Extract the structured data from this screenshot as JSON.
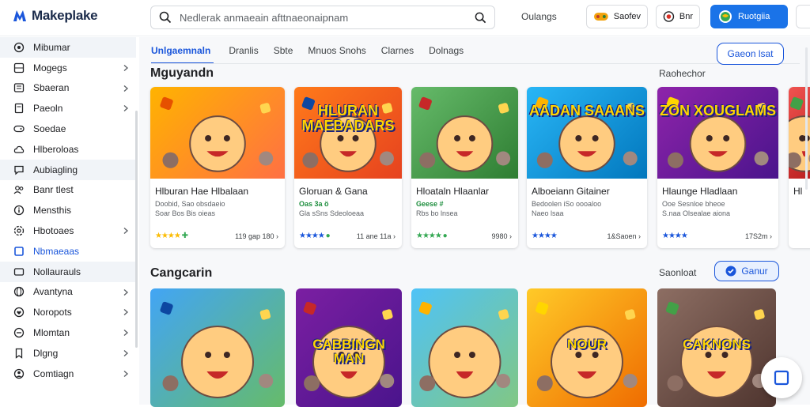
{
  "app": {
    "title": "Makeplake",
    "brand_color": "#1a56db"
  },
  "search": {
    "placeholder": "Nedlerak anmaeain afttnaeonaipnam",
    "icon": "search-icon",
    "action_icon": "search-icon"
  },
  "topbar": {
    "link_label": "Oulangs",
    "btn1_label": "Saofev",
    "btn2_label": "Bnr",
    "btn3_label": "Ruotgiia"
  },
  "sidebar": {
    "items": [
      {
        "label": "Mibumar",
        "icon": "home-icon",
        "chevron": false
      },
      {
        "label": "Mogegs",
        "icon": "grid-icon",
        "chevron": true
      },
      {
        "label": "Sbaeran",
        "icon": "list-icon",
        "chevron": true
      },
      {
        "label": "Paeoln",
        "icon": "document-icon",
        "chevron": true
      },
      {
        "label": "Soedae",
        "icon": "gamepad-icon",
        "chevron": false
      },
      {
        "label": "Hlberoloas",
        "icon": "cloud-icon",
        "chevron": false
      },
      {
        "label": "Aubiagling",
        "icon": "chat-icon",
        "chevron": false
      },
      {
        "label": "Banr tlest",
        "icon": "people-icon",
        "chevron": false
      },
      {
        "label": "Mensthis",
        "icon": "info-icon",
        "chevron": false
      },
      {
        "label": "Hbotoaes",
        "icon": "settings-icon",
        "chevron": true
      },
      {
        "label": "Nbmaeaas",
        "icon": "square-icon",
        "chevron": false,
        "active": true
      },
      {
        "label": "Nollaurauls",
        "icon": "rectangle-icon",
        "chevron": false
      },
      {
        "label": "Avantyna",
        "icon": "globe-icon",
        "chevron": true
      },
      {
        "label": "Noropots",
        "icon": "heart-icon",
        "chevron": true
      },
      {
        "label": "Mlomtan",
        "icon": "folder-icon",
        "chevron": true
      },
      {
        "label": "Dlgng",
        "icon": "bookmark-icon",
        "chevron": true
      },
      {
        "label": "Comtiagn",
        "icon": "user-icon",
        "chevron": true
      }
    ]
  },
  "tabs": [
    {
      "label": "Unlgaemnaln",
      "active": true
    },
    {
      "label": "Dranlis"
    },
    {
      "label": "Sbte"
    },
    {
      "label": "Mnuos Snohs"
    },
    {
      "label": "Clarnes"
    },
    {
      "label": "Dolnags"
    }
  ],
  "header_action": {
    "label": "Gaeon lsat"
  },
  "section1": {
    "title": "Mguyandn",
    "side_label": "Raohechor"
  },
  "cards": [
    {
      "title": "Hlburan Hae Hlbalaan",
      "line2_green": "",
      "line2": "Doobid, Sao obsdaeio",
      "line3": "Soar Bos Bis oieas",
      "stars": "★★★★",
      "star_style": "yellow",
      "rating_extra": "✚",
      "meta": "119 gap 180 ›",
      "art_text": ""
    },
    {
      "title": "Gloruan & Gana",
      "line2_green": "Oas 3a ö",
      "line2": "",
      "line3": "Gla sSns Sdeoloeaa",
      "stars": "★★★★",
      "star_style": "blue",
      "rating_extra": "●",
      "meta": "11 ane 11a ›",
      "art_text": "HLURAN MAEBADARS"
    },
    {
      "title": "Hloataln Hlaanlar",
      "line2_green": "Geese #",
      "line2": "",
      "line3": "Rbs bo lnsea",
      "stars": "★★★★",
      "star_style": "green",
      "rating_extra": "●",
      "meta": "9980 ›",
      "art_text": ""
    },
    {
      "title": "Alboeiann Gitainer",
      "line2_green": "",
      "line2": "Bedoolen iSo oooaloo",
      "line3": "Naeo lsaa",
      "stars": "★★★★",
      "star_style": "blue",
      "rating_extra": "",
      "meta": "1&Saoen ›",
      "art_text": "AADAN SAAANS"
    },
    {
      "title": "Hlaunge Hladlaan",
      "line2_green": "",
      "line2": "Ooe Sesnloe bheoe",
      "line3": "S.naa Olsealae aiona",
      "stars": "★★★★",
      "star_style": "blue",
      "rating_extra": "",
      "meta": "17S2m ›",
      "art_text": "ZON XOUGLAMS"
    },
    {
      "title": "Hl",
      "line2_green": "",
      "line2": "",
      "line3": "",
      "stars": "",
      "star_style": "blue",
      "rating_extra": "",
      "meta": "",
      "art_text": ""
    }
  ],
  "section2": {
    "title": "Cangcarin",
    "side_label": "Saonloat",
    "button_label": "Ganur"
  },
  "cards2": [
    {
      "art_text": ""
    },
    {
      "art_text": "CABBINGN MAN"
    },
    {
      "art_text": ""
    },
    {
      "art_text": "NOUR"
    },
    {
      "art_text": "CAKNONS"
    }
  ],
  "fab": {
    "icon": "square-icon"
  }
}
